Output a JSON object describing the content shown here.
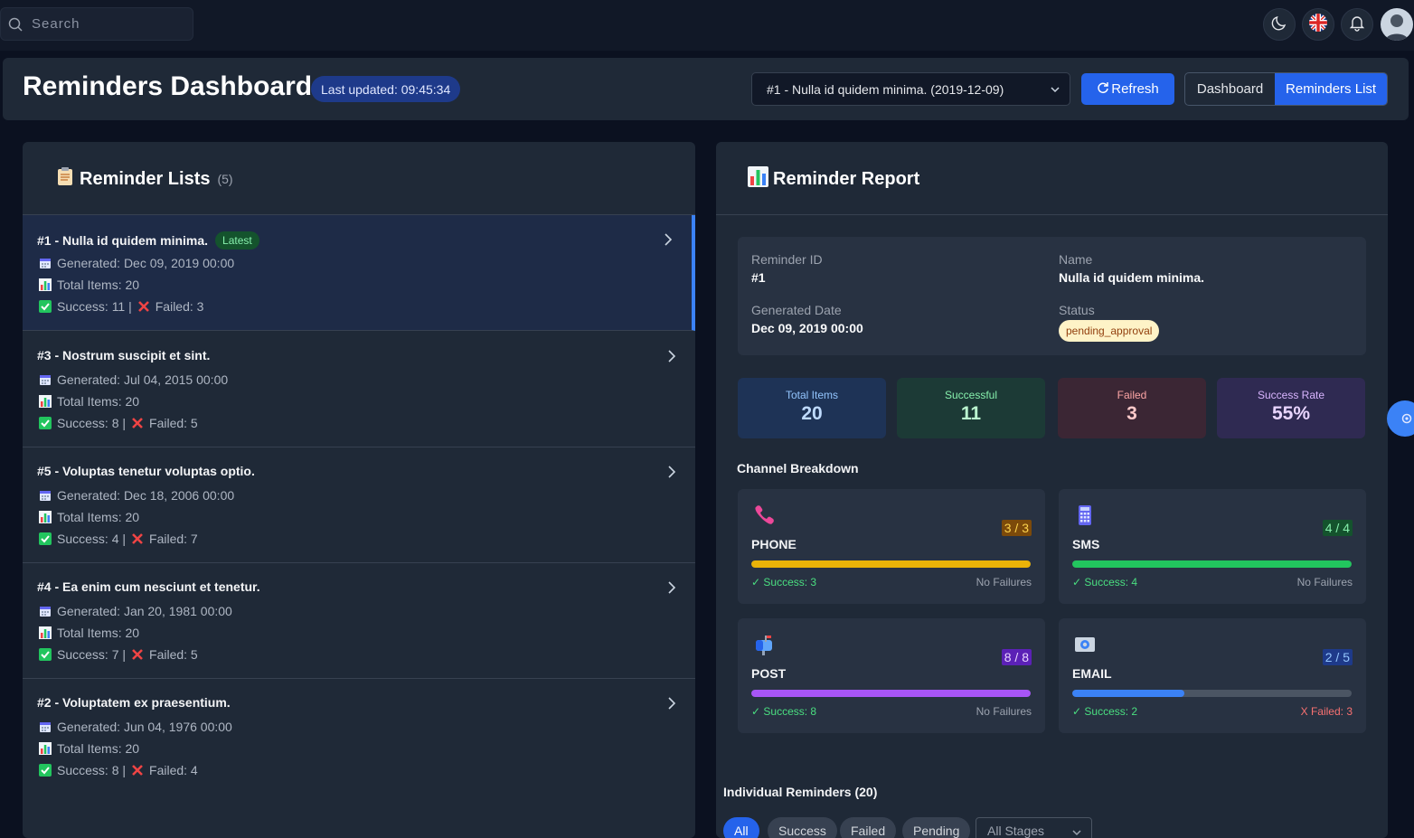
{
  "topbar": {
    "search_placeholder": "Search",
    "icons": [
      "search-icon",
      "moon-icon",
      "uk-flag-icon",
      "bell-icon",
      "avatar"
    ]
  },
  "header": {
    "title": "Reminders Dashboard",
    "last_updated": "Last updated: 09:45:34",
    "selected_list": "#1 - Nulla id quidem minima. (2019-12-09)",
    "refresh_label": "Refresh",
    "nav": {
      "dashboard": "Dashboard",
      "reminders_list": "Reminders List",
      "active": "reminders_list"
    }
  },
  "lists_panel": {
    "title": "Reminder Lists",
    "count": "(5)",
    "items": [
      {
        "name": "#1 - Nulla id quidem minima.",
        "badge": "Latest",
        "generated": "Generated: Dec 09, 2019 00:00",
        "total": "Total Items: 20",
        "success": "Success: 11 |",
        "failed": "Failed: 3",
        "active": true
      },
      {
        "name": "#3 - Nostrum suscipit et sint.",
        "badge": "",
        "generated": "Generated: Jul 04, 2015 00:00",
        "total": "Total Items: 20",
        "success": "Success: 8 |",
        "failed": "Failed: 5",
        "active": false
      },
      {
        "name": "#5 - Voluptas tenetur voluptas optio.",
        "badge": "",
        "generated": "Generated: Dec 18, 2006 00:00",
        "total": "Total Items: 20",
        "success": "Success: 4 |",
        "failed": "Failed: 7",
        "active": false
      },
      {
        "name": "#4 - Ea enim cum nesciunt et tenetur.",
        "badge": "",
        "generated": "Generated: Jan 20, 1981 00:00",
        "total": "Total Items: 20",
        "success": "Success: 7 |",
        "failed": "Failed: 5",
        "active": false
      },
      {
        "name": "#2 - Voluptatem ex praesentium.",
        "badge": "",
        "generated": "Generated: Jun 04, 1976 00:00",
        "total": "Total Items: 20",
        "success": "Success: 8 |",
        "failed": "Failed: 4",
        "active": false
      }
    ]
  },
  "report": {
    "title": "Reminder Report",
    "info": {
      "id_label": "Reminder ID",
      "id_value": "#1",
      "name_label": "Name",
      "name_value": "Nulla id quidem minima.",
      "date_label": "Generated Date",
      "date_value": "Dec 09, 2019 00:00",
      "status_label": "Status",
      "status_value": "pending_approval"
    },
    "stats": {
      "total_label": "Total Items",
      "total_value": "20",
      "success_label": "Successful",
      "success_value": "11",
      "failed_label": "Failed",
      "failed_value": "3",
      "rate_label": "Success Rate",
      "rate_value": "55%"
    },
    "channel_title": "Channel Breakdown",
    "channels": [
      {
        "name": "PHONE",
        "icon": "phone-icon",
        "ratio": "3 / 3",
        "success": "✓ Success: 3",
        "fail": "No Failures",
        "progress": 1.0,
        "color": "#eab308"
      },
      {
        "name": "SMS",
        "icon": "sms-icon",
        "ratio": "4 / 4",
        "success": "✓ Success: 4",
        "fail": "No Failures",
        "progress": 1.0,
        "color": "#22c55e"
      },
      {
        "name": "POST",
        "icon": "mailbox-icon",
        "ratio": "8 / 8",
        "success": "✓ Success: 8",
        "fail": "No Failures",
        "progress": 1.0,
        "color": "#a855f7"
      },
      {
        "name": "EMAIL",
        "icon": "email-icon",
        "ratio": "2 / 5",
        "success": "✓ Success: 2",
        "fail": "X Failed: 3",
        "progress": 0.4,
        "color": "#3b82f6"
      }
    ],
    "individual_title": "Individual Reminders (20)",
    "filters": {
      "all": "All",
      "success": "Success",
      "failed": "Failed",
      "pending": "Pending",
      "active": "all"
    },
    "stage_select": "All Stages"
  },
  "colors": {
    "accent": "#2563eb",
    "success": "#4ade80",
    "failed": "#f87171",
    "status_pending_bg": "#fef3c7"
  }
}
